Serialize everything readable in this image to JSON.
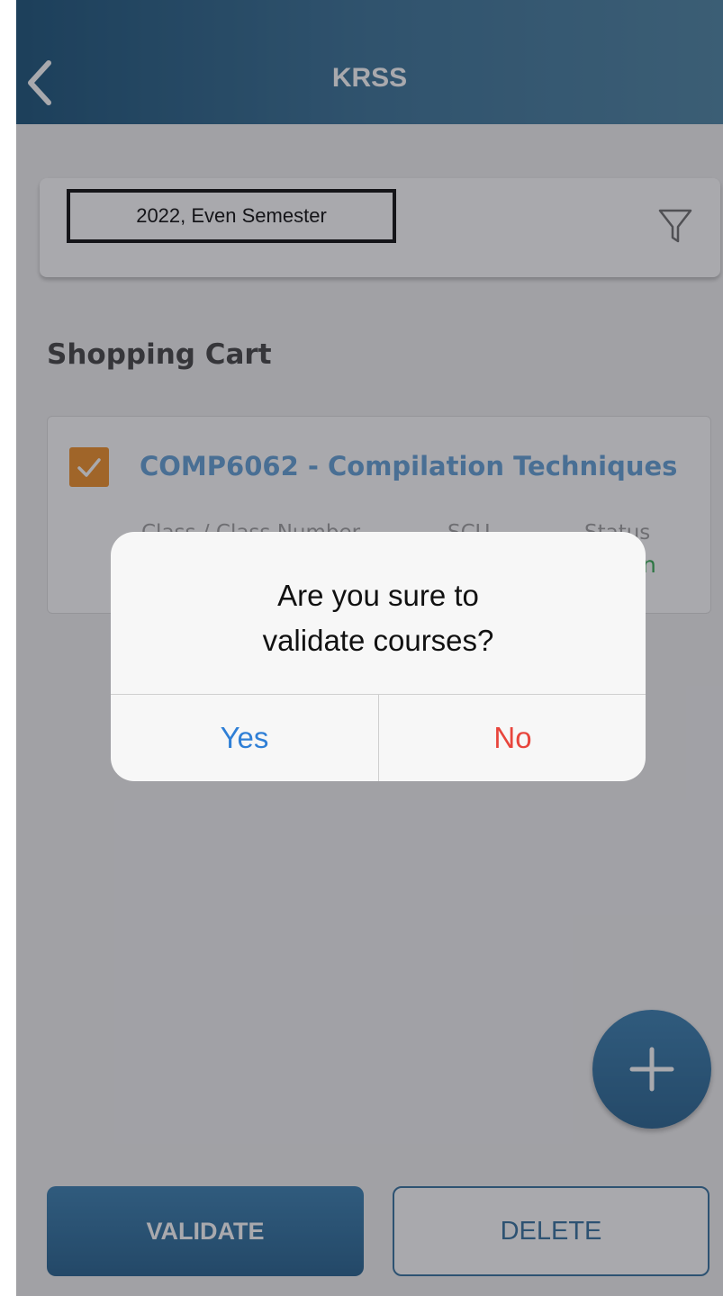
{
  "header": {
    "title": "KRSS",
    "back_icon": "chevron-left-icon"
  },
  "filter": {
    "semester": "2022, Even Semester",
    "filter_icon": "funnel-icon"
  },
  "cart": {
    "section_title": "Shopping Cart",
    "course": {
      "checked": true,
      "title": "COMP6062 - Compilation Techniques",
      "columns": {
        "class_label": "Class / Class Number",
        "scu_label": "SCU",
        "status_label": "Status"
      },
      "status_value": "n"
    }
  },
  "fab": {
    "icon": "plus-icon"
  },
  "actions": {
    "validate_label": "VALIDATE",
    "delete_label": "DELETE"
  },
  "dialog": {
    "message_line1": "Are you sure to",
    "message_line2": "validate courses?",
    "yes_label": "Yes",
    "no_label": "No"
  },
  "colors": {
    "header_start": "#0e4a72",
    "header_end": "#437e9f",
    "accent_blue": "#2f79ad",
    "checkbox_orange": "#f08a1c",
    "course_title_blue": "#5b9bd5",
    "status_green": "#2ba84a",
    "yes_blue": "#2f7fd6",
    "no_red": "#e8453c"
  }
}
